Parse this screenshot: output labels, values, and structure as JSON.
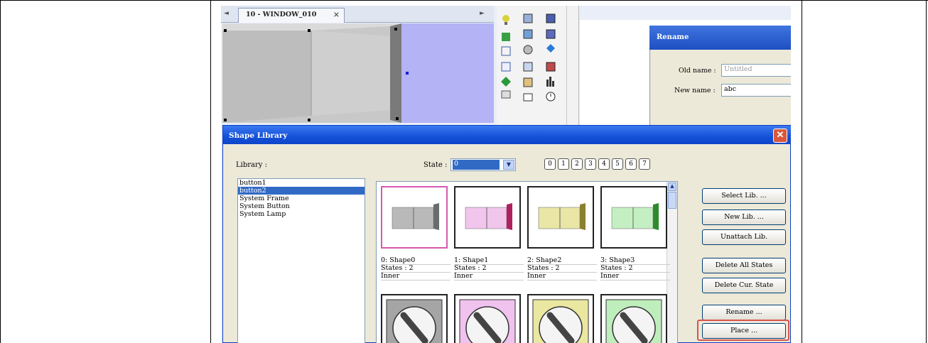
{
  "editor": {
    "tab_label": "10 - WINDOW_010",
    "tab_close": "×",
    "tab_prev": "◄",
    "tab_next": "►"
  },
  "rename_dialog": {
    "title": "Rename",
    "old_name_label": "Old name :",
    "old_name_value": "Untitled",
    "new_name_label": "New name :",
    "new_name_value": "abc"
  },
  "shape_library": {
    "title": "Shape Library",
    "close_glyph": "✕",
    "library_label": "Library :",
    "library_items": [
      "button1",
      "button2",
      "System Frame",
      "System Button",
      "System Lamp"
    ],
    "selected_library_index": 1,
    "state_label": "State :",
    "state_value": "0",
    "state_buttons": [
      "0",
      "1",
      "2",
      "3",
      "4",
      "5",
      "6",
      "7"
    ],
    "shapes": [
      {
        "name": "0: Shape0",
        "states": "States : 2",
        "type": "Inner",
        "fill": "#b9b9b9",
        "shade": "#6b6b6b"
      },
      {
        "name": "1: Shape1",
        "states": "States : 2",
        "type": "Inner",
        "fill": "#f2c6ec",
        "shade": "#b0205e"
      },
      {
        "name": "2: Shape2",
        "states": "States : 2",
        "type": "Inner",
        "fill": "#e9e6a6",
        "shade": "#8a8030"
      },
      {
        "name": "3: Shape3",
        "states": "States : 2",
        "type": "Inner",
        "fill": "#c4efc2",
        "shade": "#2f8a2d"
      }
    ],
    "knob_colors": [
      "#a5a5a5",
      "#f0c2ee",
      "#eae7a0",
      "#bfeebd"
    ],
    "buttons": {
      "select_lib": "Select Lib. ...",
      "new_lib": "New Lib. ...",
      "unattach_lib": "Unattach Lib.",
      "delete_all_states": "Delete All States",
      "delete_cur_state": "Delete Cur. State",
      "rename": "Rename ...",
      "place": "Place ..."
    },
    "highlight_color": "#d9534f"
  },
  "colors": {
    "title_blue": "#1451d8",
    "selection_blue": "#316ac5",
    "dialog_bg": "#ece9d8"
  }
}
